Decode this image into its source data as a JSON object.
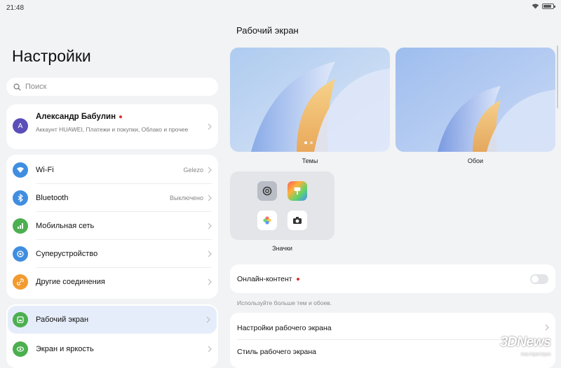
{
  "status_bar": {
    "time": "21:48"
  },
  "left": {
    "title": "Настройки",
    "search": {
      "placeholder": "Поиск"
    },
    "account": {
      "avatar_letter": "A",
      "name": "Александр Бабулин",
      "subtitle": "Аккаунт HUAWEI, Платежи и покупки, Облако и прочее"
    },
    "items": [
      {
        "label": "Wi-Fi",
        "value": "Gelezo",
        "icon": "wifi-icon",
        "color": "#3f8ee0"
      },
      {
        "label": "Bluetooth",
        "value": "Выключено",
        "icon": "bluetooth-icon",
        "color": "#3f8ee0"
      },
      {
        "label": "Мобильная сеть",
        "value": "",
        "icon": "cellular-icon",
        "color": "#4caf50"
      },
      {
        "label": "Суперустройство",
        "value": "",
        "icon": "super-device-icon",
        "color": "#3f8ee0"
      },
      {
        "label": "Другие соединения",
        "value": "",
        "icon": "link-icon",
        "color": "#f29b30"
      }
    ],
    "bottom_items": [
      {
        "label": "Рабочий экран",
        "icon": "home-screen-icon",
        "color": "#4caf50",
        "selected": true
      },
      {
        "label": "Экран и яркость",
        "icon": "display-icon",
        "color": "#4caf50",
        "selected": false
      }
    ]
  },
  "right": {
    "title": "Рабочий экран",
    "themes_label": "Темы",
    "wallpaper_label": "Обои",
    "icons_label": "Значки",
    "online": {
      "label": "Онлайн-контент",
      "enabled": false
    },
    "hint": "Используйте больше тем и обоев.",
    "settings_rows": [
      {
        "label": "Настройки рабочего экрана"
      },
      {
        "label": "Стиль рабочего экрана"
      }
    ]
  },
  "watermark": {
    "text": "3DNews",
    "sub": "Daily Digital Digest"
  },
  "colors": {
    "accent": "#3f8ee0",
    "selected_bg": "#e6edfa",
    "badge_red": "#e0302a"
  }
}
